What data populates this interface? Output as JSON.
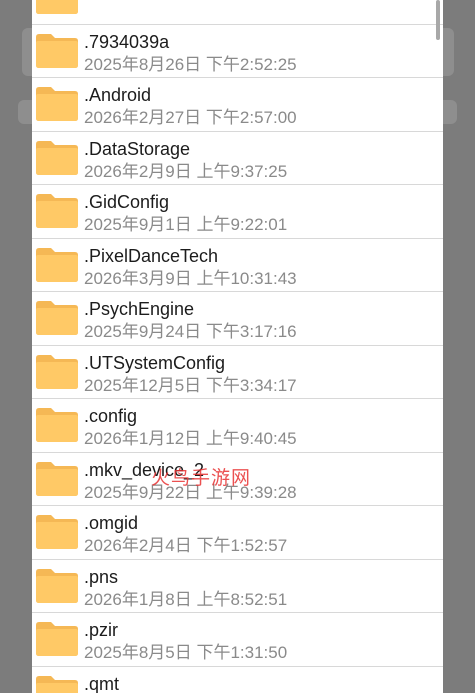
{
  "colors": {
    "folder": "#ffc966",
    "folder_tab": "#f5b855",
    "name_text": "#1c1c1c",
    "date_text": "#8a8a8a",
    "overlay": "#7c7c7c",
    "watermark": "#e83232"
  },
  "watermark": "火鸟手游网",
  "files": [
    {
      "name": "..",
      "date": "",
      "icon": "folder-icon"
    },
    {
      "name": ".7934039a",
      "date": "2025年8月26日 下午2:52:25",
      "icon": "folder-icon"
    },
    {
      "name": ".Android",
      "date": "2026年2月27日 下午2:57:00",
      "icon": "folder-icon"
    },
    {
      "name": ".DataStorage",
      "date": "2026年2月9日 上午9:37:25",
      "icon": "folder-icon"
    },
    {
      "name": ".GidConfig",
      "date": "2025年9月1日 上午9:22:01",
      "icon": "folder-icon"
    },
    {
      "name": ".PixelDanceTech",
      "date": "2026年3月9日 上午10:31:43",
      "icon": "folder-icon"
    },
    {
      "name": ".PsychEngine",
      "date": "2025年9月24日 下午3:17:16",
      "icon": "folder-icon"
    },
    {
      "name": ".UTSystemConfig",
      "date": "2025年12月5日 下午3:34:17",
      "icon": "folder-icon"
    },
    {
      "name": ".config",
      "date": "2026年1月12日 上午9:40:45",
      "icon": "folder-icon"
    },
    {
      "name": ".mkv_device_2",
      "date": "2025年9月22日 上午9:39:28",
      "icon": "folder-icon"
    },
    {
      "name": ".omgid",
      "date": "2026年2月4日 下午1:52:57",
      "icon": "folder-icon"
    },
    {
      "name": ".pns",
      "date": "2026年1月8日 上午8:52:51",
      "icon": "folder-icon"
    },
    {
      "name": ".pzir",
      "date": "2025年8月5日 下午1:31:50",
      "icon": "folder-icon"
    },
    {
      "name": ".qmt",
      "date": "",
      "icon": "folder-icon"
    }
  ]
}
